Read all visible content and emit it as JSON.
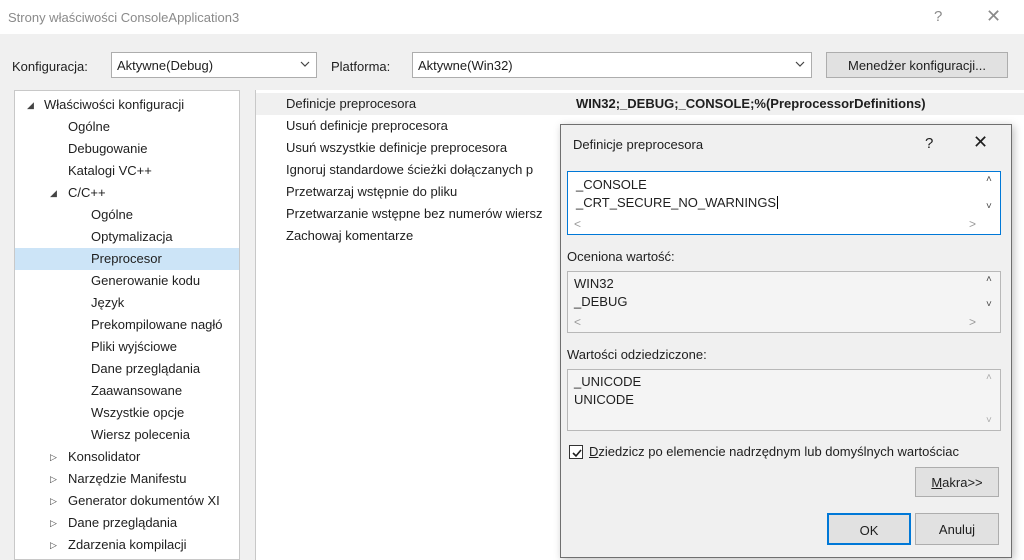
{
  "window": {
    "title": "Strony właściwości ConsoleApplication3",
    "help_glyph": "?",
    "close_glyph": "✕"
  },
  "config_bar": {
    "config_label": "Konfiguracja:",
    "config_value": "Aktywne(Debug)",
    "platform_label": "Platforma:",
    "platform_value": "Aktywne(Win32)",
    "manager_button": "Menedżer konfiguracji..."
  },
  "tree": {
    "items": [
      {
        "label": "Właściwości konfiguracji",
        "expander": "◢",
        "level": 0
      },
      {
        "label": "Ogólne",
        "expander": "",
        "level": 1
      },
      {
        "label": "Debugowanie",
        "expander": "",
        "level": 1
      },
      {
        "label": "Katalogi VC++",
        "expander": "",
        "level": 1
      },
      {
        "label": "C/C++",
        "expander": "◢",
        "level": 1
      },
      {
        "label": "Ogólne",
        "expander": "",
        "level": 2
      },
      {
        "label": "Optymalizacja",
        "expander": "",
        "level": 2
      },
      {
        "label": "Preprocesor",
        "expander": "",
        "level": 2,
        "selected": true
      },
      {
        "label": "Generowanie kodu",
        "expander": "",
        "level": 2
      },
      {
        "label": "Język",
        "expander": "",
        "level": 2
      },
      {
        "label": "Prekompilowane nagłó",
        "expander": "",
        "level": 2
      },
      {
        "label": "Pliki wyjściowe",
        "expander": "",
        "level": 2
      },
      {
        "label": "Dane przeglądania",
        "expander": "",
        "level": 2
      },
      {
        "label": "Zaawansowane",
        "expander": "",
        "level": 2
      },
      {
        "label": "Wszystkie opcje",
        "expander": "",
        "level": 2
      },
      {
        "label": "Wiersz polecenia",
        "expander": "",
        "level": 2
      },
      {
        "label": "Konsolidator",
        "expander": "▷",
        "level": 1
      },
      {
        "label": "Narzędzie Manifestu",
        "expander": "▷",
        "level": 1
      },
      {
        "label": "Generator dokumentów XI",
        "expander": "▷",
        "level": 1
      },
      {
        "label": "Dane przeglądania",
        "expander": "▷",
        "level": 1
      },
      {
        "label": "Zdarzenia kompilacji",
        "expander": "▷",
        "level": 1
      }
    ]
  },
  "properties": {
    "rows": [
      {
        "name": "Definicje preprocesora",
        "value": "WIN32;_DEBUG;_CONSOLE;%(PreprocessorDefinitions)"
      },
      {
        "name": "Usuń definicje preprocesora",
        "value": ""
      },
      {
        "name": "Usuń wszystkie definicje preprocesora",
        "value": ""
      },
      {
        "name": "Ignoruj standardowe ścieżki dołączanych p",
        "value": ""
      },
      {
        "name": "Przetwarzaj wstępnie do pliku",
        "value": ""
      },
      {
        "name": "Przetwarzanie wstępne bez numerów wiersz",
        "value": ""
      },
      {
        "name": "Zachowaj komentarze",
        "value": ""
      }
    ]
  },
  "dialog": {
    "title": "Definicje preprocesora",
    "help_glyph": "?",
    "close_glyph": "✕",
    "edit_lines": [
      "_CONSOLE",
      "_CRT_SECURE_NO_WARNINGS"
    ],
    "evaluated_label": "Oceniona wartość:",
    "evaluated_lines": [
      "WIN32",
      "_DEBUG"
    ],
    "inherited_label": "Wartości odziedziczone:",
    "inherited_lines": [
      "_UNICODE",
      "UNICODE"
    ],
    "inherit_checkbox_label": "Dziedzicz po elemencie nadrzędnym lub domyślnych wartościac",
    "inherit_checked": true,
    "macros_button": "Makra>>",
    "ok_button": "OK",
    "cancel_button": "Anuluj"
  }
}
